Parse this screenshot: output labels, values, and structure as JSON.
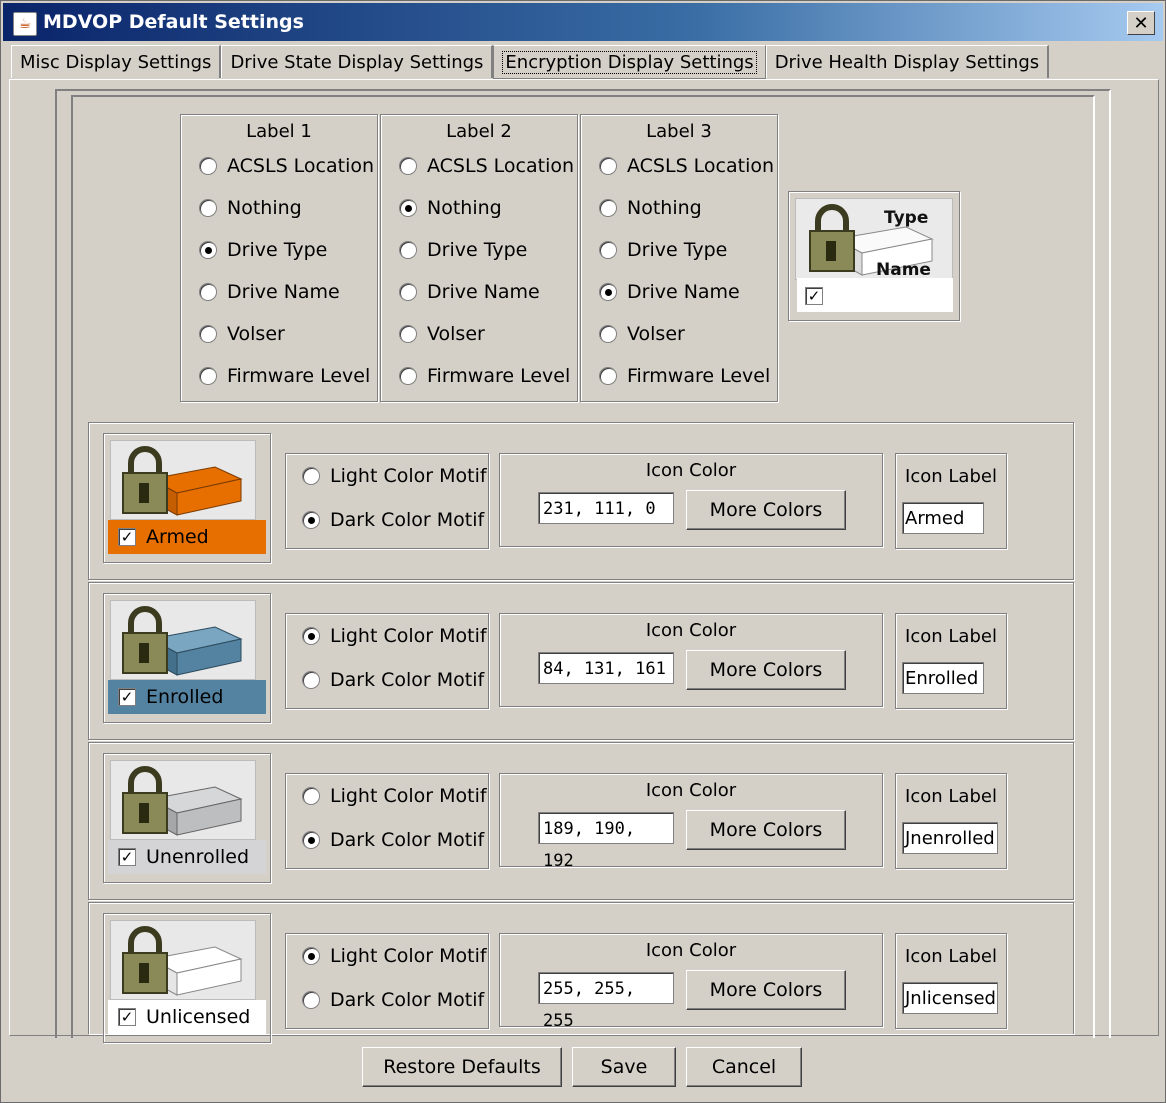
{
  "window": {
    "title": "MDVOP Default Settings",
    "close_glyph": "✕"
  },
  "tabs": [
    {
      "label": "Misc Display Settings",
      "active": false
    },
    {
      "label": "Drive State Display Settings",
      "active": false
    },
    {
      "label": "Encryption Display Settings",
      "active": true
    },
    {
      "label": "Drive Health Display Settings",
      "active": false
    }
  ],
  "label_groups": [
    {
      "title": "Label 1",
      "options": [
        "ACSLS Location",
        "Nothing",
        "Drive Type",
        "Drive Name",
        "Volser",
        "Firmware Level"
      ],
      "selected": "Drive Type"
    },
    {
      "title": "Label 2",
      "options": [
        "ACSLS Location",
        "Nothing",
        "Drive Type",
        "Drive Name",
        "Volser",
        "Firmware Level"
      ],
      "selected": "Nothing"
    },
    {
      "title": "Label 3",
      "options": [
        "ACSLS Location",
        "Nothing",
        "Drive Type",
        "Drive Name",
        "Volser",
        "Firmware Level"
      ],
      "selected": "Drive Name"
    }
  ],
  "preview": {
    "type_label": "Type",
    "name_label": "Name",
    "checked": true
  },
  "states": [
    {
      "label": "Armed",
      "checked": true,
      "label_bg": "#e76f00",
      "motif": "dark",
      "light_motif_label": "Light Color Motif",
      "dark_motif_label": "Dark Color Motif",
      "icon_color_title": "Icon Color",
      "rgb": "231, 111, 0",
      "drive_color": "#e76f00",
      "more_colors_label": "More Colors",
      "icon_label_title": "Icon Label",
      "icon_label_value": "Armed"
    },
    {
      "label": "Enrolled",
      "checked": true,
      "label_bg": "#5483a1",
      "motif": "light",
      "light_motif_label": "Light Color Motif",
      "dark_motif_label": "Dark Color Motif",
      "icon_color_title": "Icon Color",
      "rgb": "84, 131, 161",
      "drive_color": "#5483a1",
      "more_colors_label": "More Colors",
      "icon_label_title": "Icon Label",
      "icon_label_value": "Enrolled"
    },
    {
      "label": "Unenrolled",
      "checked": true,
      "label_bg": "#bdbec0",
      "motif": "dark",
      "light_motif_label": "Light Color Motif",
      "dark_motif_label": "Dark Color Motif",
      "icon_color_title": "Icon Color",
      "rgb": "189, 190, 192",
      "drive_color": "#bdbec0",
      "more_colors_label": "More Colors",
      "icon_label_title": "Icon Label",
      "icon_label_value": "Jnenrolled"
    },
    {
      "label": "Unlicensed",
      "checked": true,
      "label_bg": "#ffffff",
      "motif": "light",
      "light_motif_label": "Light Color Motif",
      "dark_motif_label": "Dark Color Motif",
      "icon_color_title": "Icon Color",
      "rgb": "255, 255, 255",
      "drive_color": "#ffffff",
      "more_colors_label": "More Colors",
      "icon_label_title": "Icon Label",
      "icon_label_value": "Jnlicensed"
    }
  ],
  "buttons": {
    "restore": "Restore Defaults",
    "save": "Save",
    "cancel": "Cancel"
  }
}
